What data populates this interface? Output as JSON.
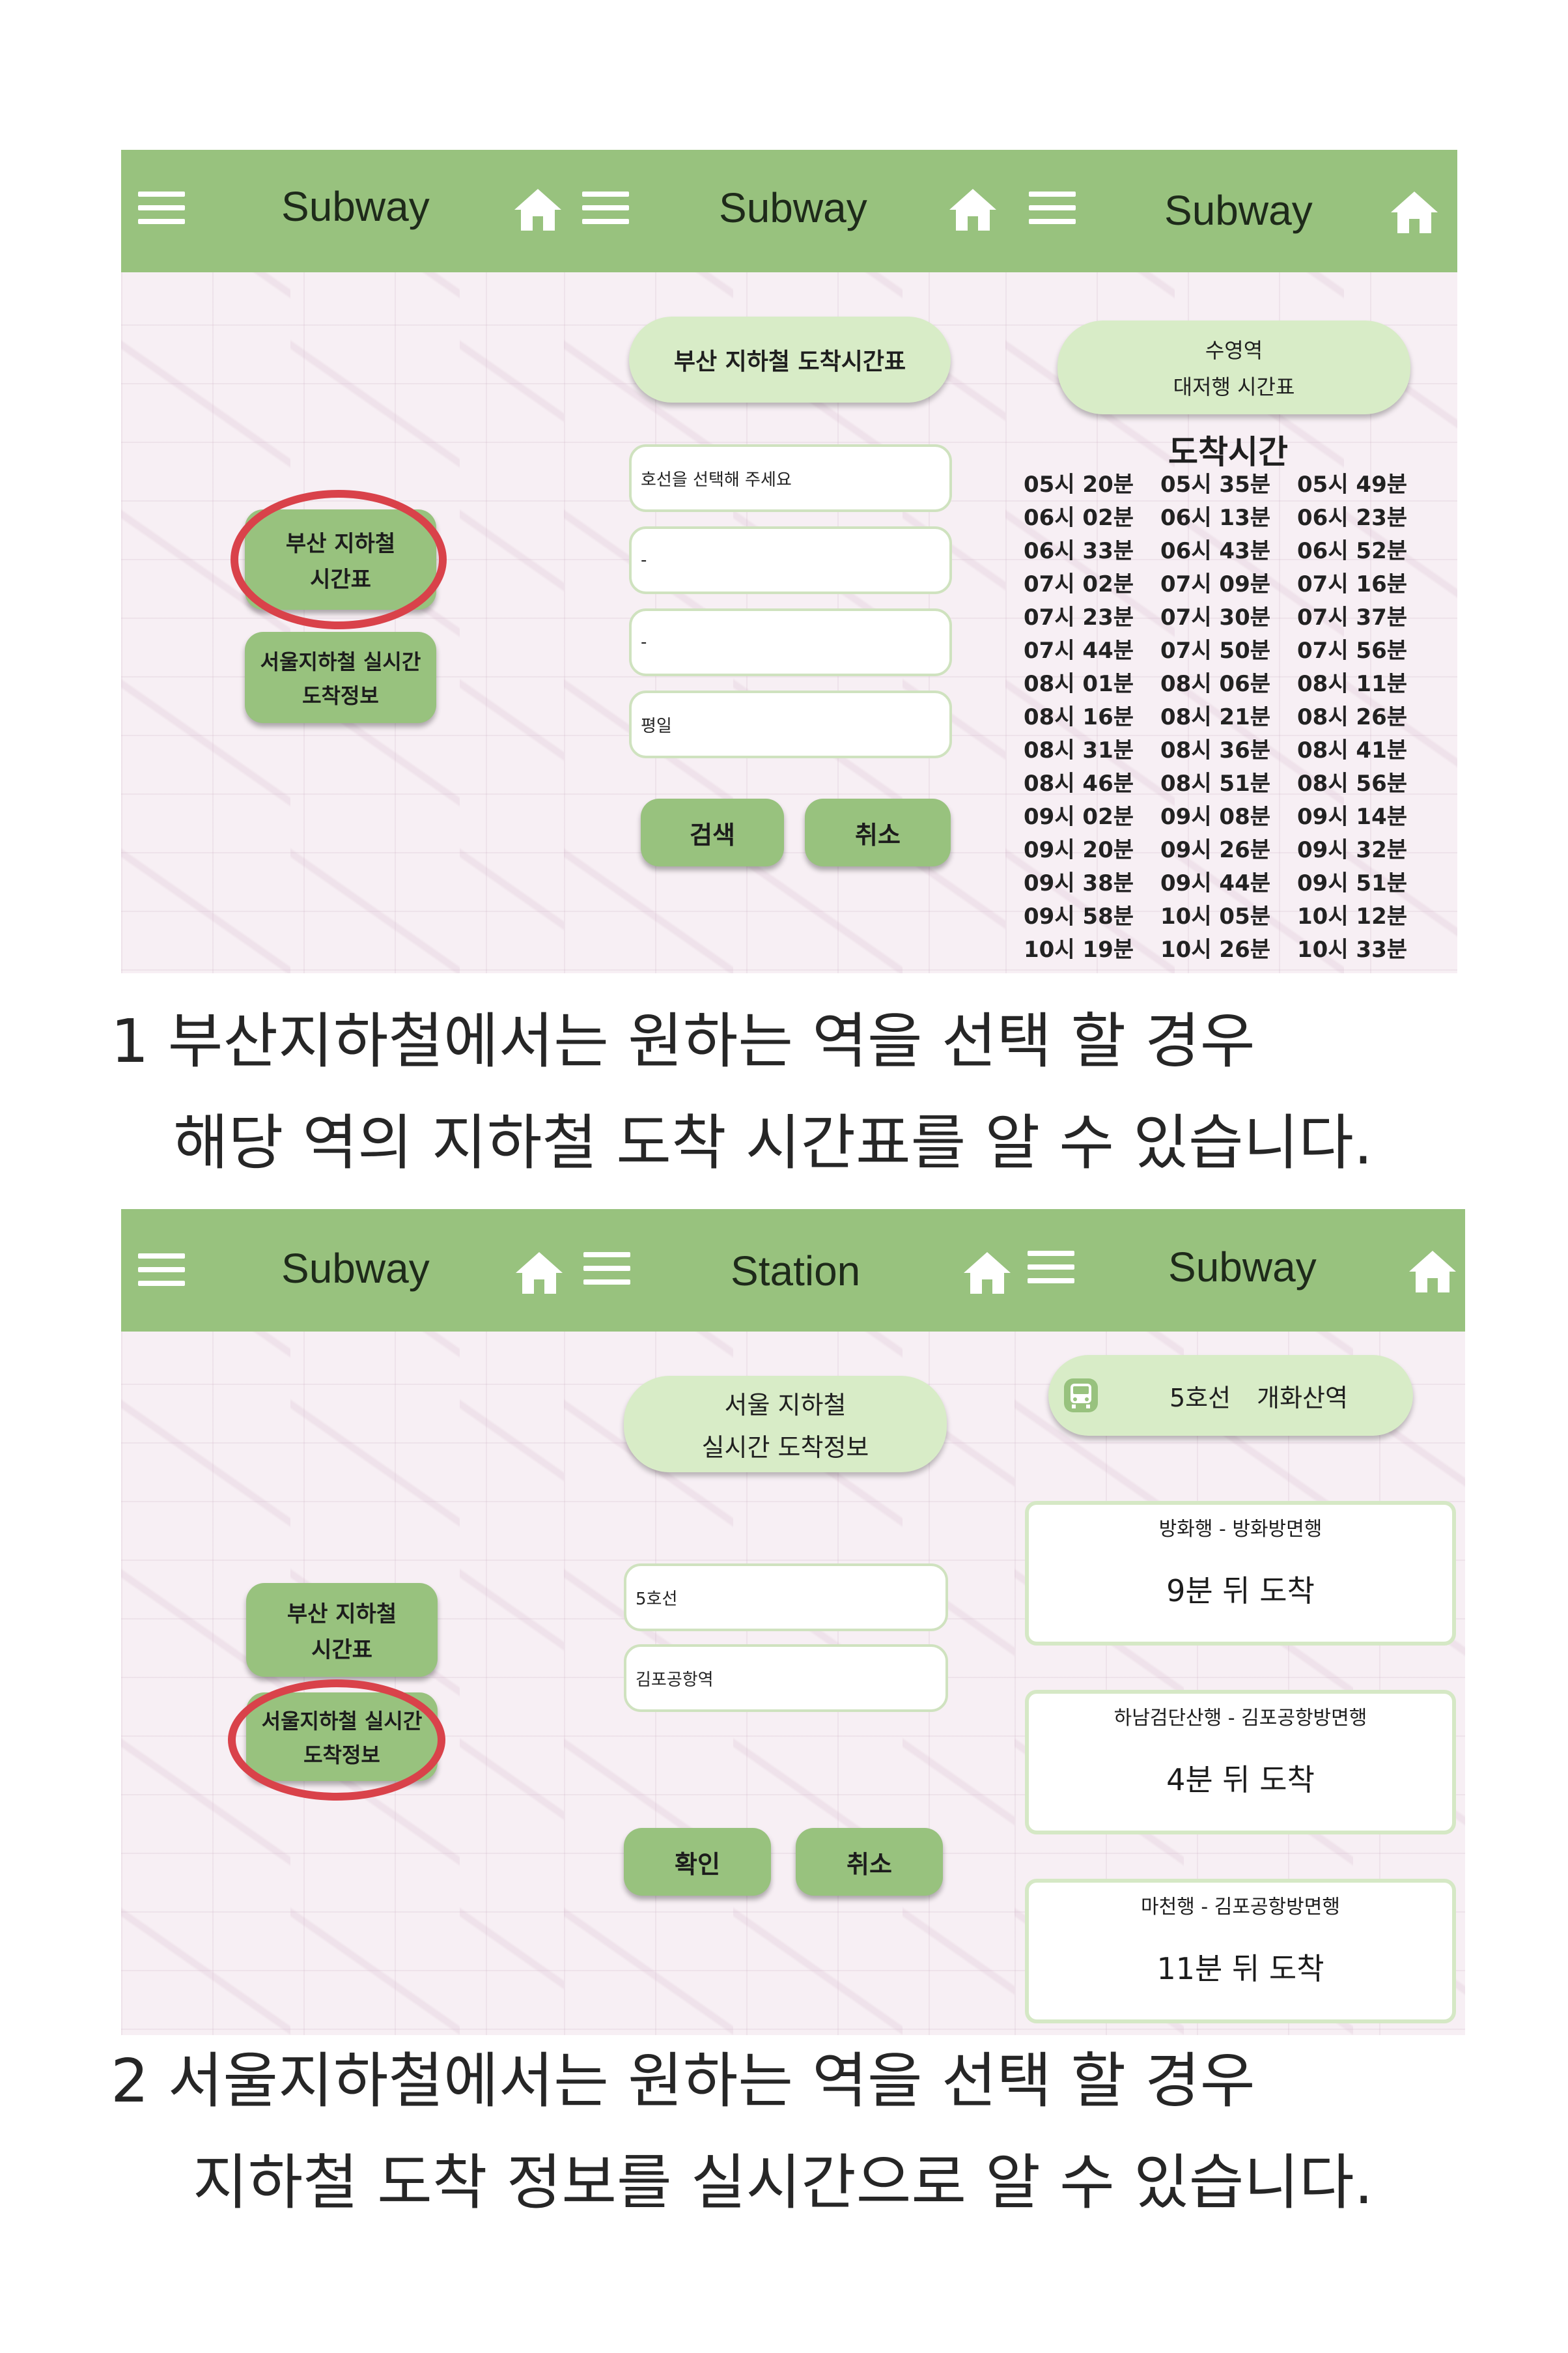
{
  "colors": {
    "header": "#98c27e",
    "pill": "#d8ecc7",
    "ring": "#d9424a"
  },
  "section1": {
    "screen1": {
      "title": "Subway",
      "btn_busan": [
        "부산 지하철",
        "시간표"
      ],
      "btn_seoul": [
        "서울지하철 실시간",
        "도착정보"
      ]
    },
    "screen2": {
      "title": "Subway",
      "pill": "부산 지하철 도착시간표",
      "fields": [
        "호선을 선택해 주세요",
        "-",
        "-",
        "평일"
      ],
      "search": "검색",
      "cancel": "취소"
    },
    "screen3": {
      "title": "Subway",
      "station": "수영역",
      "direction": "대저행 시간표",
      "heading": "도착시간",
      "times": [
        "05시 20분",
        "05시 35분",
        "05시 49분",
        "06시 02분",
        "06시 13분",
        "06시 23분",
        "06시 33분",
        "06시 43분",
        "06시 52분",
        "07시 02분",
        "07시 09분",
        "07시 16분",
        "07시 23분",
        "07시 30분",
        "07시 37분",
        "07시 44분",
        "07시 50분",
        "07시 56분",
        "08시 01분",
        "08시 06분",
        "08시 11분",
        "08시 16분",
        "08시 21분",
        "08시 26분",
        "08시 31분",
        "08시 36분",
        "08시 41분",
        "08시 46분",
        "08시 51분",
        "08시 56분",
        "09시 02분",
        "09시 08분",
        "09시 14분",
        "09시 20분",
        "09시 26분",
        "09시 32분",
        "09시 38분",
        "09시 44분",
        "09시 51분",
        "09시 58분",
        "10시 05분",
        "10시 12분",
        "10시 19분",
        "10시 26분",
        "10시 33분"
      ]
    },
    "caption": [
      "1  부산지하철에서는 원하는 역을 선택 할 경우",
      "해당 역의 지하철 도착 시간표를 알 수 있습니다."
    ]
  },
  "section2": {
    "screen1": {
      "title": "Subway",
      "btn_busan": [
        "부산 지하철",
        "시간표"
      ],
      "btn_seoul": [
        "서울지하철 실시간",
        "도착정보"
      ]
    },
    "screen2": {
      "title": "Station",
      "pill": [
        "서울 지하철",
        "실시간 도착정보"
      ],
      "fields": [
        "5호선",
        "김포공항역"
      ],
      "confirm": "확인",
      "cancel": "취소"
    },
    "screen3": {
      "title": "Subway",
      "header_line": "5호선",
      "header_station": "개화산역",
      "arrivals": [
        {
          "direction": "방화행 - 방화방면행",
          "time": "9분 뒤 도착"
        },
        {
          "direction": "하남검단산행 - 김포공항방면행",
          "time": "4분 뒤 도착"
        },
        {
          "direction": "마천행 - 김포공항방면행",
          "time": "11분 뒤 도착"
        }
      ]
    },
    "caption": [
      "2  서울지하철에서는 원하는 역을 선택 할 경우",
      "지하철 도착 정보를 실시간으로 알 수 있습니다."
    ]
  }
}
